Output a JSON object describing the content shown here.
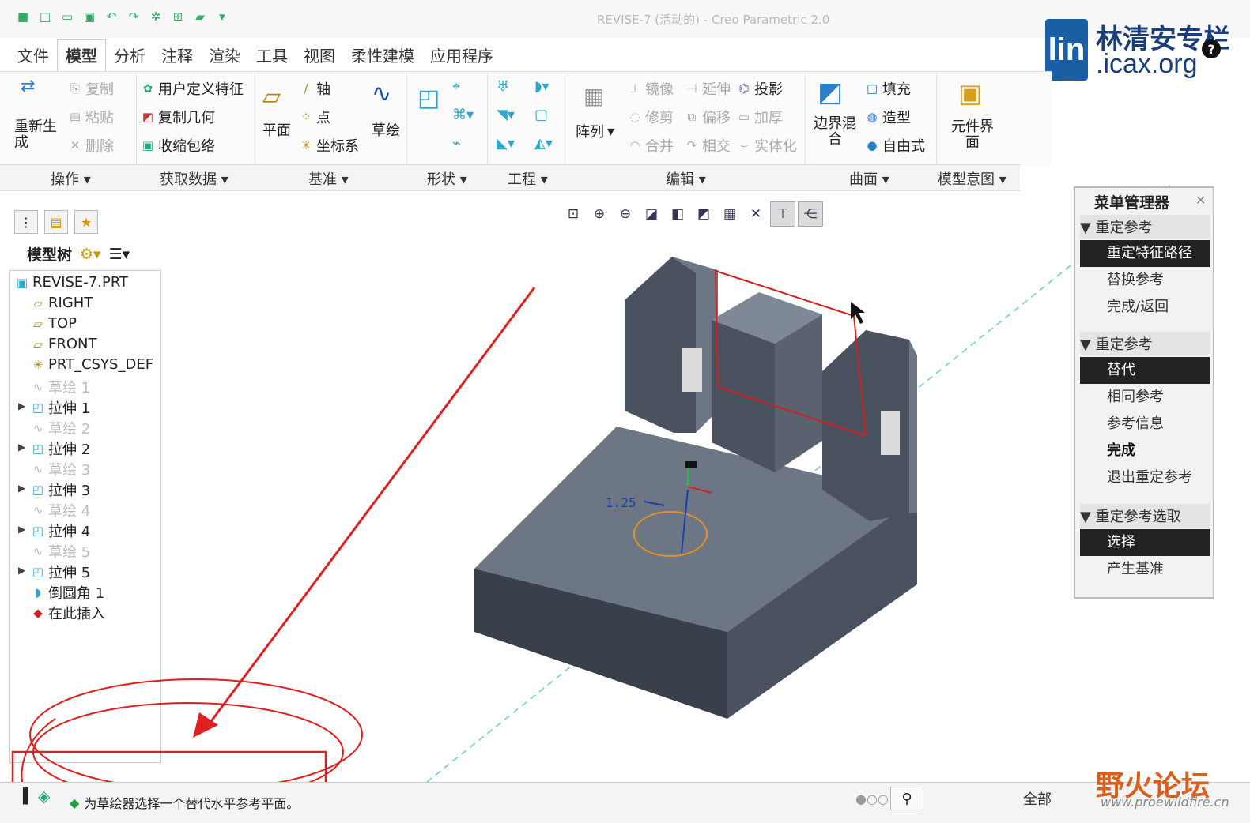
{
  "window": {
    "title": "REVISE-7 (活动的) - Creo Parametric 2.0"
  },
  "branding": {
    "logo_mark": "lin",
    "name": "林清安专栏",
    "site": ".icax.org",
    "forum_name": "野火论坛",
    "forum_url": "www.proewildfire.cn"
  },
  "tabs": [
    "文件",
    "模型",
    "分析",
    "注释",
    "渲染",
    "工具",
    "视图",
    "柔性建模",
    "应用程序"
  ],
  "ribbon": {
    "regen": "重新生成",
    "copy": "复制",
    "paste": "粘贴",
    "delete": "删除",
    "udf": "用户定义特征",
    "copy_geom": "复制几何",
    "shrinkwrap": "收缩包络",
    "plane": "平面",
    "axis": "轴",
    "point": "点",
    "csys": "坐标系",
    "sketch": "草绘",
    "pattern": "阵列",
    "mirror": "镜像",
    "extend": "延伸",
    "project": "投影",
    "trim": "修剪",
    "offset": "偏移",
    "thicken": "加厚",
    "merge": "合并",
    "intersect": "相交",
    "solidify": "实体化",
    "boundary_blend": "边界混合",
    "fill": "填充",
    "style": "造型",
    "freestyle": "自由式",
    "component_interface": "元件界面"
  },
  "groups": [
    "操作",
    "获取数据",
    "基准",
    "形状",
    "工程",
    "编辑",
    "曲面",
    "模型意图"
  ],
  "tree": {
    "header": "模型树",
    "nodes": [
      "REVISE-7.PRT",
      "RIGHT",
      "TOP",
      "FRONT",
      "PRT_CSYS_DEF",
      "草绘 1",
      "拉伸 1",
      "草绘 2",
      "拉伸 2",
      "草绘 3",
      "拉伸 3",
      "草绘 4",
      "拉伸 4",
      "草绘 5",
      "拉伸 5",
      "倒圆角 1",
      "在此插入"
    ]
  },
  "menu_manager": {
    "title": "菜单管理器",
    "sec1": "重定参考",
    "sec1_items": [
      "重定特征路径",
      "替换参考",
      "完成/返回"
    ],
    "sec2": "重定参考",
    "sec2_items": [
      "替代",
      "相同参考",
      "参考信息",
      "完成",
      "退出重定参考"
    ],
    "sec3": "重定参考选取",
    "sec3_items": [
      "选择",
      "产生基准"
    ]
  },
  "viewport": {
    "dimension": "1.25"
  },
  "status": {
    "message": "为草绘器选择一个替代水平参考平面。",
    "filter": "全部"
  },
  "colors": {
    "annotation": "#e02020",
    "model_top": "#6d7684",
    "model_side": "#4a5260",
    "model_dark": "#3a404b",
    "highlight": "#d02020"
  }
}
